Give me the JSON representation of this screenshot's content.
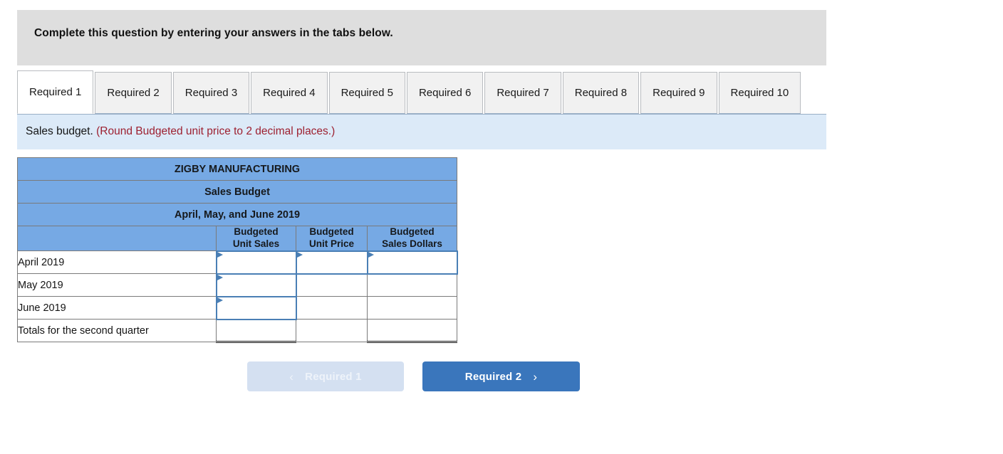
{
  "banner": {
    "text": "Complete this question by entering your answers in the tabs below."
  },
  "tabs": {
    "active_index": 0,
    "items": [
      {
        "label": "Required 1"
      },
      {
        "label": "Required 2"
      },
      {
        "label": "Required 3"
      },
      {
        "label": "Required 4"
      },
      {
        "label": "Required 5"
      },
      {
        "label": "Required 6"
      },
      {
        "label": "Required 7"
      },
      {
        "label": "Required 8"
      },
      {
        "label": "Required 9"
      },
      {
        "label": "Required 10"
      }
    ]
  },
  "instruction": {
    "main": "Sales budget.",
    "note": "(Round Budgeted unit price to 2 decimal places.)"
  },
  "table": {
    "title_line_1": "ZIGBY MANUFACTURING",
    "title_line_2": "Sales Budget",
    "title_line_3": "April, May, and June 2019",
    "column_headers": [
      "",
      "Budgeted Unit Sales",
      "Budgeted Unit Price",
      "Budgeted Sales Dollars"
    ],
    "column_header_lines": {
      "units_1": "Budgeted",
      "units_2": "Unit Sales",
      "price_1": "Budgeted",
      "price_2": "Unit Price",
      "dollars_1": "Budgeted",
      "dollars_2": "Sales Dollars"
    },
    "rows": [
      {
        "label": "April 2019",
        "unit_sales": "",
        "unit_price": "",
        "sales_dollars": ""
      },
      {
        "label": "May 2019",
        "unit_sales": "",
        "unit_price": "",
        "sales_dollars": ""
      },
      {
        "label": "June 2019",
        "unit_sales": "",
        "unit_price": "",
        "sales_dollars": ""
      },
      {
        "label": "Totals for the second quarter",
        "unit_sales": "",
        "unit_price": "",
        "sales_dollars": ""
      }
    ]
  },
  "navigation": {
    "prev_label": "Required 1",
    "next_label": "Required 2",
    "prev_icon": "chevron-left-icon",
    "next_icon": "chevron-right-icon",
    "prev_chevron": "‹",
    "next_chevron": "›"
  },
  "colors": {
    "banner_gray": "#dedede",
    "table_header_blue": "#76a9e4",
    "instruction_blue": "#dceaf8",
    "note_red": "#9d2030",
    "button_blue": "#3a76bc",
    "button_disabled": "#d4e0f1",
    "cell_focus_border": "#4a7fb5"
  }
}
